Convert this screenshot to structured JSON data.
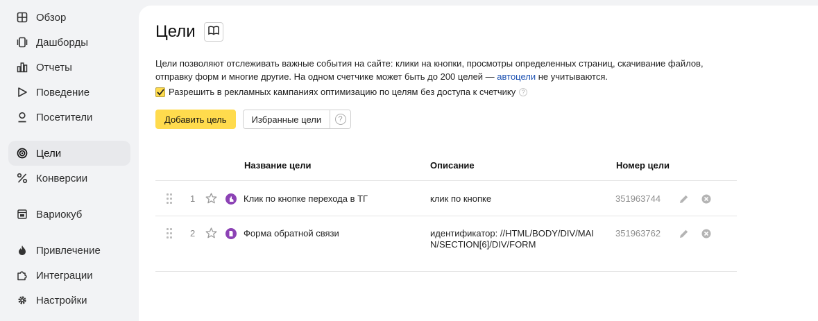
{
  "sidebar": {
    "items": [
      {
        "label": "Обзор",
        "icon": "grid-icon"
      },
      {
        "label": "Дашборды",
        "icon": "dashboards-icon"
      },
      {
        "label": "Отчеты",
        "icon": "bar-chart-icon"
      },
      {
        "label": "Поведение",
        "icon": "play-icon"
      },
      {
        "label": "Посетители",
        "icon": "person-icon"
      },
      {
        "label": "Цели",
        "icon": "target-icon",
        "active": true
      },
      {
        "label": "Конверсии",
        "icon": "percent-icon"
      },
      {
        "label": "Вариокуб",
        "icon": "variocube-icon"
      },
      {
        "label": "Привлечение",
        "icon": "flame-icon"
      },
      {
        "label": "Интеграции",
        "icon": "puzzle-icon"
      },
      {
        "label": "Настройки",
        "icon": "gear-icon"
      }
    ]
  },
  "page": {
    "title": "Цели",
    "description_part1": "Цели позволяют отслеживать важные события на сайте: клики на кнопки, просмотры определенных страниц, скачивание файлов, отправку форм и многие другие. На одном счетчике может быть до 200 целей — ",
    "description_link": "автоцели",
    "description_part2": " не учитываются.",
    "checkbox_label": "Разрешить в рекламных кампаниях оптимизацию по целям без доступа к счетчику",
    "checkbox_checked": true,
    "help_glyph": "?",
    "add_button": "Добавить цель",
    "favorites_button": "Избранные цели"
  },
  "table": {
    "headers": {
      "name": "Название цели",
      "description": "Описание",
      "number": "Номер цели"
    },
    "rows": [
      {
        "index": "1",
        "name": "Клик по кнопке перехода в ТГ",
        "description": "клик по кнопке",
        "id": "351963744",
        "type_icon": "click-icon"
      },
      {
        "index": "2",
        "name": "Форма обратной связи",
        "description": "идентификатор: //HTML/BODY/DIV/MAIN/SECTION[6]/DIV/FORM",
        "id": "351963762",
        "type_icon": "form-icon"
      }
    ]
  },
  "colors": {
    "accent": "#ffdb4d",
    "link": "#1a4fb0",
    "goal_icon": "#8c42b5",
    "sidebar_bg": "#f2f3f5"
  }
}
